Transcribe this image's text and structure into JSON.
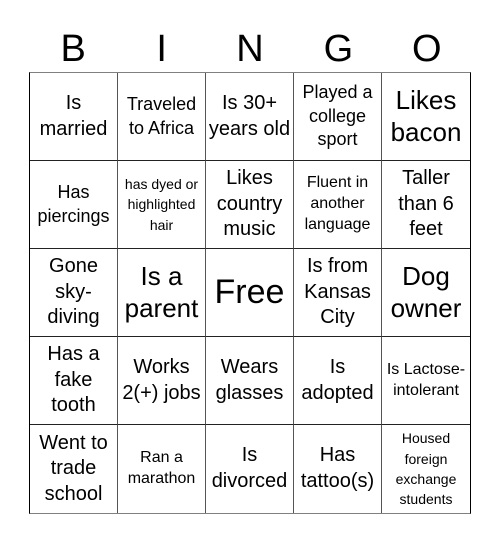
{
  "header": {
    "letters": [
      "B",
      "I",
      "N",
      "G",
      "O"
    ]
  },
  "card": {
    "rows": [
      [
        "Is married",
        "Traveled to Africa",
        "Is 30+ years old",
        "Played a college sport",
        "Likes bacon"
      ],
      [
        "Has piercings",
        "has dyed or highlighted hair",
        "Likes country music",
        "Fluent in another language",
        "Taller than 6 feet"
      ],
      [
        "Gone sky-diving",
        "Is a parent",
        "Free",
        "Is from Kansas City",
        "Dog owner"
      ],
      [
        "Has a fake tooth",
        "Works 2(+) jobs",
        "Wears glasses",
        "Is adopted",
        "Is Lactose-intolerant"
      ],
      [
        "Went to trade school",
        "Ran a marathon",
        "Is divorced",
        "Has tattoo(s)",
        "Housed foreign exchange students"
      ]
    ],
    "free_space": "Free"
  },
  "colors": {
    "text": "#000000",
    "background": "#ffffff",
    "grid_line": "#555555"
  }
}
